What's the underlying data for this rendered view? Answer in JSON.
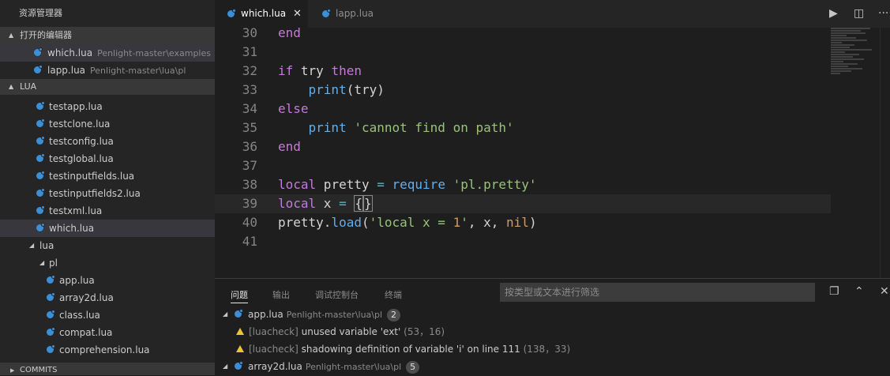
{
  "sidebar": {
    "title": "资源管理器",
    "open_editors_header": "打开的编辑器",
    "open_editors": [
      {
        "name": "which.lua",
        "path": "Penlight-master\\examples"
      },
      {
        "name": "lapp.lua",
        "path": "Penlight-master\\lua\\pl"
      }
    ],
    "lua_header": "LUA",
    "tree": [
      {
        "label": "testapp.lua"
      },
      {
        "label": "testclone.lua"
      },
      {
        "label": "testconfig.lua"
      },
      {
        "label": "testglobal.lua"
      },
      {
        "label": "testinputfields.lua"
      },
      {
        "label": "testinputfields2.lua"
      },
      {
        "label": "testxml.lua"
      },
      {
        "label": "which.lua"
      },
      {
        "label": "lua"
      },
      {
        "label": "pl"
      },
      {
        "label": "app.lua"
      },
      {
        "label": "array2d.lua"
      },
      {
        "label": "class.lua"
      },
      {
        "label": "compat.lua"
      },
      {
        "label": "comprehension.lua"
      }
    ],
    "commits_header": "COMMITS"
  },
  "tabs": [
    {
      "label": "which.lua",
      "active": true
    },
    {
      "label": "lapp.lua",
      "active": false
    }
  ],
  "editor": {
    "line_numbers": [
      "30",
      "31",
      "32",
      "33",
      "34",
      "35",
      "36",
      "37",
      "38",
      "39",
      "40",
      "41"
    ]
  },
  "panel": {
    "tabs": [
      "问题",
      "输出",
      "调试控制台",
      "终端"
    ],
    "filter_placeholder": "按类型或文本进行筛选",
    "problems": [
      {
        "file": "app.lua",
        "path": "Penlight-master\\lua\\pl",
        "count": "2"
      },
      {
        "source": "[luacheck]",
        "message": "unused variable 'ext'",
        "location": "(53，16)"
      },
      {
        "source": "[luacheck]",
        "message": "shadowing definition of variable 'i' on line 111",
        "location": "(138，33)"
      },
      {
        "file": "array2d.lua",
        "path": "Penlight-master\\lua\\pl",
        "count": "5"
      }
    ]
  },
  "colors": {
    "keyword": "#c678dd",
    "function": "#61afef",
    "string": "#98c379",
    "number": "#d19a66",
    "warning": "#e9c53a",
    "lua_icon": "#3b8fd6"
  }
}
